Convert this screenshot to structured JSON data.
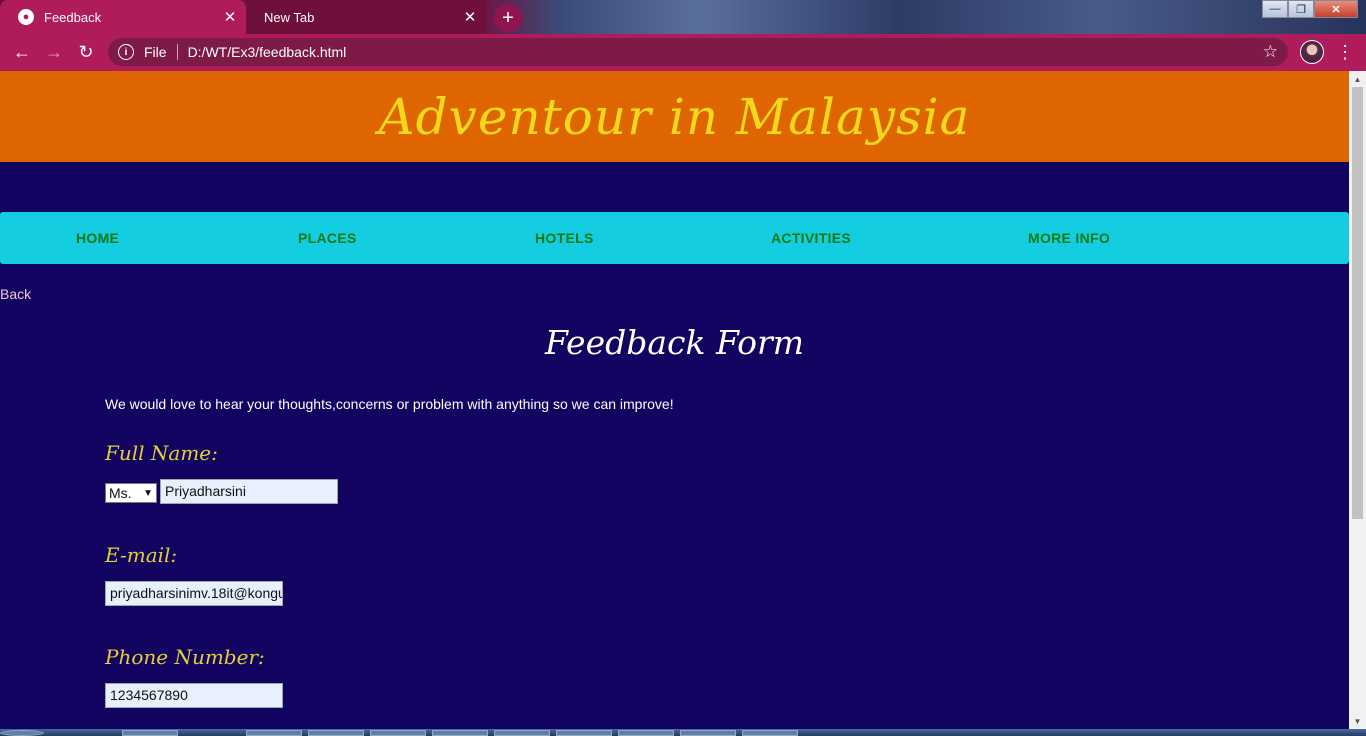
{
  "browser": {
    "active_tab": "Feedback",
    "inactive_tab": "New Tab",
    "url_scheme": "File",
    "url": "D:/WT/Ex3/feedback.html",
    "icons": {
      "back": "arrow-left-icon",
      "forward": "arrow-right-icon",
      "reload": "reload-icon",
      "info": "info-icon",
      "bookmark": "star-icon",
      "menu": "kebab-menu-icon"
    }
  },
  "site": {
    "title": "Adventour in Malaysia",
    "nav": [
      "HOME",
      "PLACES",
      "HOTELS",
      "ACTIVITIES",
      "MORE INFO"
    ],
    "back_link": "Back"
  },
  "form": {
    "title": "Feedback Form",
    "intro": "We would love to hear your thoughts,concerns or problem with anything so we can improve!",
    "full_name_label": "Full Name:",
    "salutation": "Ms.",
    "full_name": "Priyadharsini",
    "email_label": "E-mail:",
    "email": "priyadharsinimv.18it@kongu",
    "phone_label": "Phone Number:",
    "phone": "1234567890"
  },
  "colors": {
    "banner": "#df6500",
    "title_text": "#f4d81c",
    "page_bg": "#120360",
    "navbar": "#14cde0",
    "nav_text": "#0d7a12",
    "label_text": "#e4cf3a",
    "browser_accent": "#b01b5b"
  }
}
